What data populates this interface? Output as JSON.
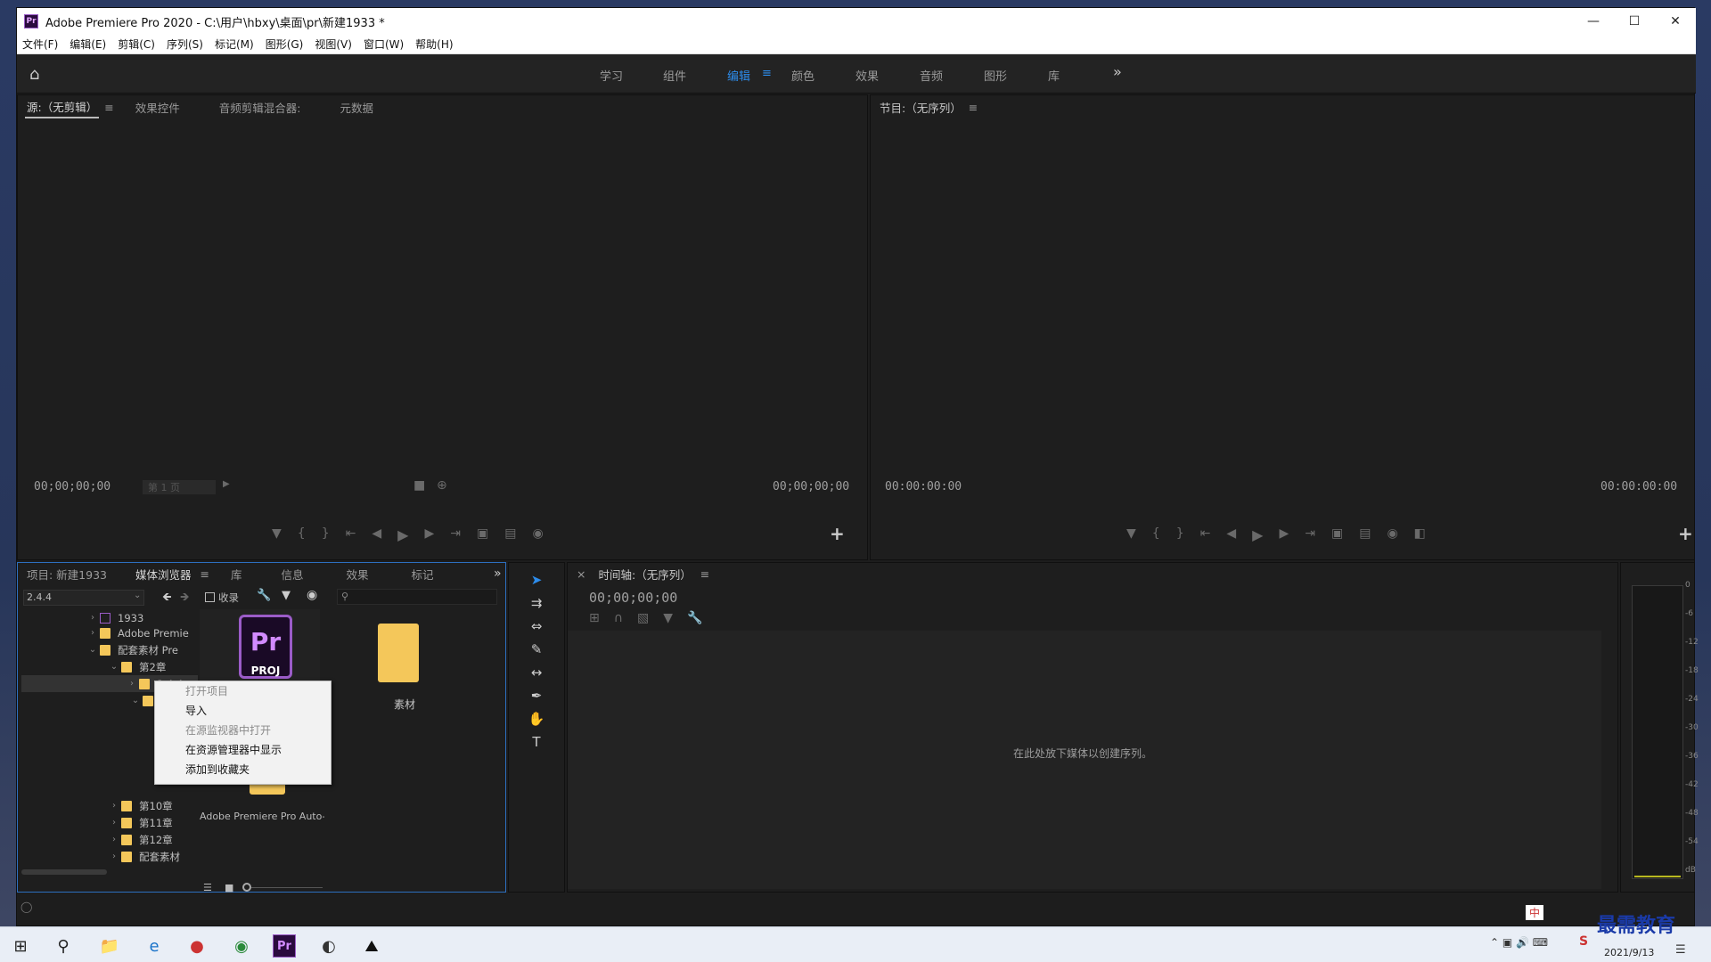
{
  "window": {
    "title": "Adobe Premiere Pro 2020 - C:\\用户\\hbxy\\桌面\\pr\\新建1933 *",
    "app_icon": "Pr"
  },
  "menu": [
    "文件(F)",
    "编辑(E)",
    "剪辑(C)",
    "序列(S)",
    "标记(M)",
    "图形(G)",
    "视图(V)",
    "窗口(W)",
    "帮助(H)"
  ],
  "workspaces": {
    "items": [
      "学习",
      "组件",
      "编辑",
      "颜色",
      "效果",
      "音频",
      "图形",
      "库"
    ],
    "active": "编辑",
    "more": "»"
  },
  "source_panel": {
    "tabs": [
      "源:（无剪辑）",
      "效果控件",
      "音频剪辑混合器:",
      "元数据"
    ],
    "timecode_left": "00;00;00;00",
    "timecode_right": "00;00;00;00",
    "page": "第 1 页"
  },
  "program_panel": {
    "tab": "节目:（无序列）",
    "timecode_left": "00:00:00:00",
    "timecode_right": "00:00:00:00"
  },
  "project_panel": {
    "tabs": [
      "项目: 新建1933",
      "媒体浏览器",
      "库",
      "信息",
      "效果",
      "标记"
    ],
    "path_dropdown": "2.4.4",
    "ingest_label": "收录",
    "tree": [
      "1933",
      "Adobe Premie",
      "配套素材 Pre",
      "第2章",
      "2.4.4",
      "第10章",
      "第11章",
      "第12章",
      "配套素材"
    ],
    "thumbnails": [
      {
        "label": "PROJ",
        "icon": "Pr"
      },
      {
        "label": "素材"
      },
      {
        "label": "Adobe Premiere Pro Auto-S..."
      }
    ]
  },
  "context_menu": {
    "items": [
      {
        "label": "打开项目",
        "disabled": true
      },
      {
        "label": "导入",
        "disabled": false
      },
      {
        "label": "在源监视器中打开",
        "disabled": true
      },
      {
        "label": "在资源管理器中显示",
        "disabled": false
      },
      {
        "label": "添加到收藏夹",
        "disabled": false
      }
    ]
  },
  "timeline": {
    "tab": "时间轴:（无序列）",
    "timecode": "00;00;00;00",
    "drop_hint": "在此处放下媒体以创建序列。"
  },
  "meter": {
    "ticks": [
      "0",
      "-6",
      "-12",
      "-18",
      "-24",
      "-30",
      "-36",
      "-42",
      "-48",
      "-54"
    ],
    "unit": "dB"
  },
  "taskbar": {
    "date": "2021/9/13",
    "watermark": "最需教育",
    "ime": "中"
  }
}
